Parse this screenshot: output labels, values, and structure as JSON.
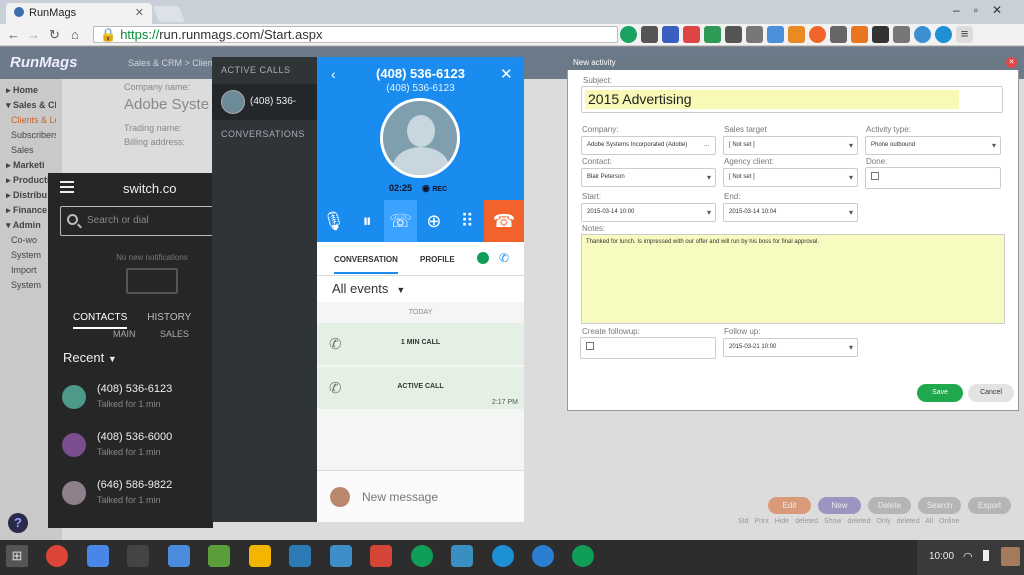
{
  "browser": {
    "tab_title": "RunMags",
    "url_scheme": "https://",
    "url_rest": "run.runmags.com/Start.aspx"
  },
  "app": {
    "logo": "RunMags",
    "breadcrumb": "Sales & CRM > Clien",
    "sidebar": [
      "Home",
      "Sales & CRM",
      "Clients & Leads",
      "Subscribers",
      "Sales",
      "Marketi",
      "Producti",
      "Distribu",
      "Finance",
      "Admin",
      "Co-wo",
      "System",
      "Import",
      "System"
    ],
    "fields": {
      "company_name_label": "Company name:",
      "company_name_value": "Adobe Syste",
      "trading_name_label": "Trading name:",
      "billing_label": "Billing address:"
    },
    "buttons": [
      "Edit",
      "New",
      "Delete",
      "Search",
      "Export"
    ],
    "options": "Std Print Hide deleted Show deleted Only deleted All Online"
  },
  "switch": {
    "title": "switch.co",
    "search_placeholder": "Search or dial",
    "no_notifications": "No new notifications",
    "tabs": [
      "CONTACTS",
      "HISTORY"
    ],
    "subtabs": [
      "MAIN",
      "SALES"
    ],
    "recent_label": "Recent",
    "contacts": [
      {
        "number": "(408) 536-6123",
        "sub": "Talked for 1 min",
        "color": "#4d9a8a"
      },
      {
        "number": "(408) 536-6000",
        "sub": "Talked for 1 min",
        "color": "#7a4d8e"
      },
      {
        "number": "(646) 586-9822",
        "sub": "Talked for 1 min",
        "color": "#8e7f8a"
      }
    ]
  },
  "active_calls": {
    "header": "ACTIVE CALLS",
    "item": "(408) 536-",
    "conversations_header": "CONVERSATIONS"
  },
  "call": {
    "number": "(408) 536-6123",
    "number_sub": "(408) 536-6123",
    "timer": "02:25",
    "rec": "REC",
    "tab_conversation": "CONVERSATION",
    "tab_profile": "PROFILE",
    "filter": "All events",
    "today": "TODAY",
    "events": [
      {
        "label": "1 MIN CALL",
        "time": ""
      },
      {
        "label": "ACTIVE CALL",
        "time": "2:17 PM"
      }
    ],
    "new_message_placeholder": "New message",
    "accent": "#1a8cf0",
    "hangup_color": "#f2632c"
  },
  "activity": {
    "dialog_title": "New activity",
    "subject_label": "Subject:",
    "subject": "2015 Advertising",
    "company_label": "Company:",
    "company": "Adobe Systems Incorporated (Adobe)",
    "company_suffix": "...",
    "sales_target_label": "Sales target",
    "sales_target": "[ Not set ]",
    "activity_type_label": "Activity type:",
    "activity_type": "Phone outbound",
    "contact_label": "Contact:",
    "contact": "Blair Peterson",
    "agency_label": "Agency client:",
    "agency": "[ Not set ]",
    "done_label": "Done:",
    "start_label": "Start:",
    "start": "2015-03-14 10:00",
    "end_label": "End:",
    "end": "2015-03-14 10:04",
    "notes_label": "Notes:",
    "notes": "Thanked for lunch.  Is impressed with our offer and will run by his boss for final approval.",
    "followup_label": "Create followup:",
    "follow_up_label": "Follow up:",
    "follow_up": "2015-03-21 10:00",
    "save": "Save",
    "cancel": "Cancel"
  },
  "taskbar": {
    "time": "10:00",
    "icons": [
      "chrome-icon",
      "calendar-icon",
      "app-icon",
      "files-icon",
      "evernote-icon",
      "drive-icon",
      "trello-icon",
      "app-icon",
      "gmail-icon",
      "hangouts-icon",
      "app-icon",
      "skype-icon",
      "chat-icon",
      "hangouts-icon"
    ]
  }
}
